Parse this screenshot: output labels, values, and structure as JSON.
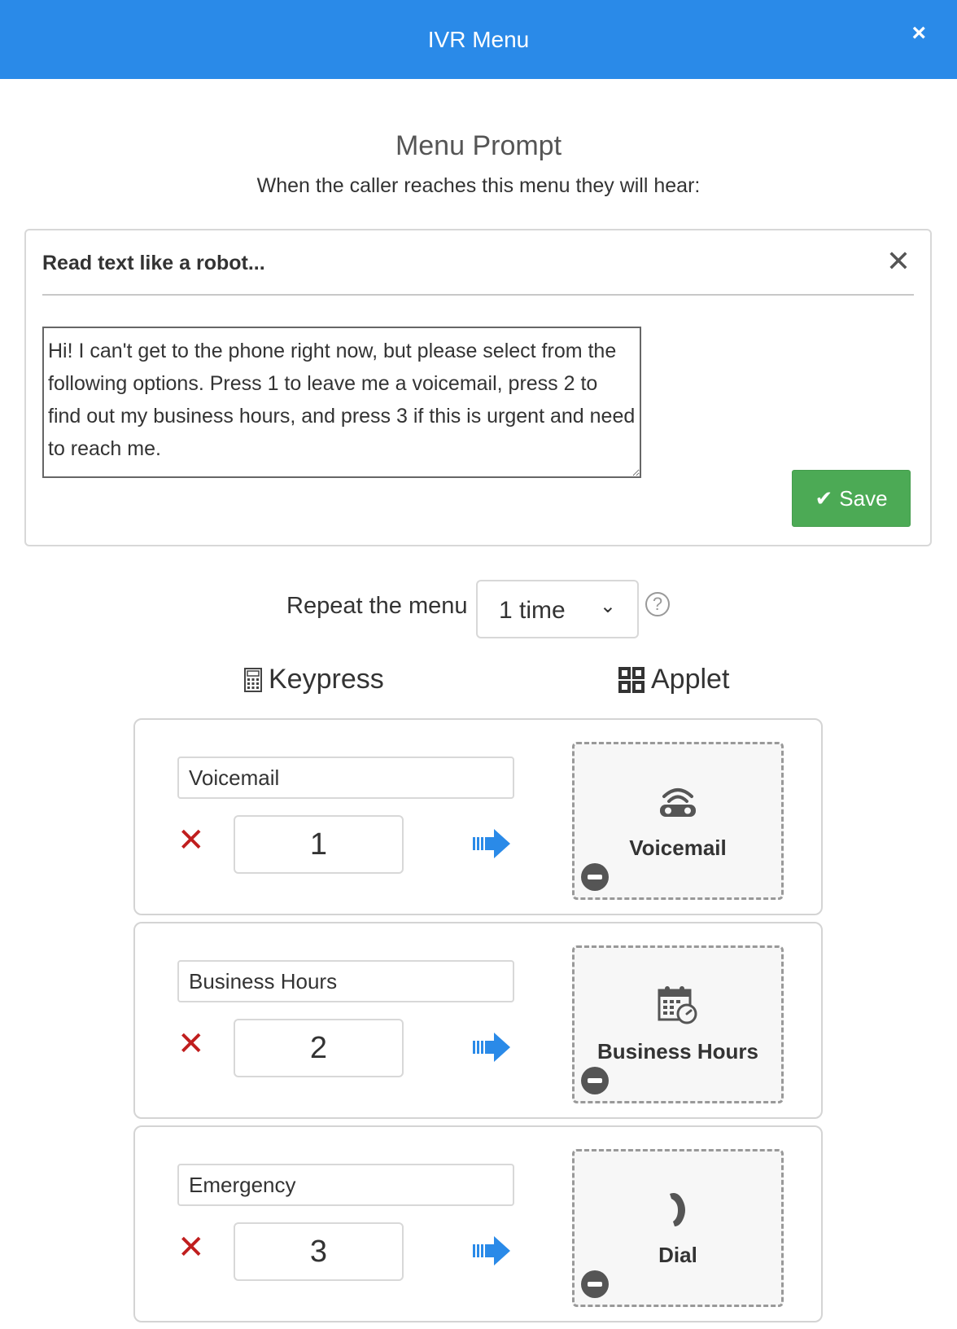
{
  "header": {
    "title": "IVR Menu",
    "close_icon": "×"
  },
  "prompt_section": {
    "title": "Menu Prompt",
    "subtitle": "When the caller reaches this menu they will hear:",
    "card_title": "Read text like a robot...",
    "card_close_icon": "✕",
    "text": "Hi! I can't get to the phone right now, but please select from the following options. Press 1 to leave me a voicemail, press 2 to find out my business hours, and press 3 if this is urgent and need to reach me. ",
    "save_label": "Save",
    "save_icon": "✔"
  },
  "repeat": {
    "label": "Repeat the menu",
    "selected": "1 time",
    "chevron": "⌄",
    "help_icon": "?"
  },
  "columns": {
    "keypress": "Keypress",
    "applet": "Applet"
  },
  "options": [
    {
      "name": "Voicemail",
      "key": "1",
      "remove_icon": "✕",
      "applet": {
        "label": "Voicemail",
        "icon": "voicemail-icon"
      }
    },
    {
      "name": "Business Hours",
      "key": "2",
      "remove_icon": "✕",
      "applet": {
        "label": "Business Hours",
        "icon": "calendar-clock-icon"
      }
    },
    {
      "name": "Emergency",
      "key": "3",
      "remove_icon": "✕",
      "applet": {
        "label": "Dial",
        "icon": "phone-icon"
      }
    }
  ],
  "colors": {
    "header": "#2a8ae8",
    "save": "#4caa55",
    "remove": "#c01e1e",
    "arrow": "#2a8ae8"
  }
}
